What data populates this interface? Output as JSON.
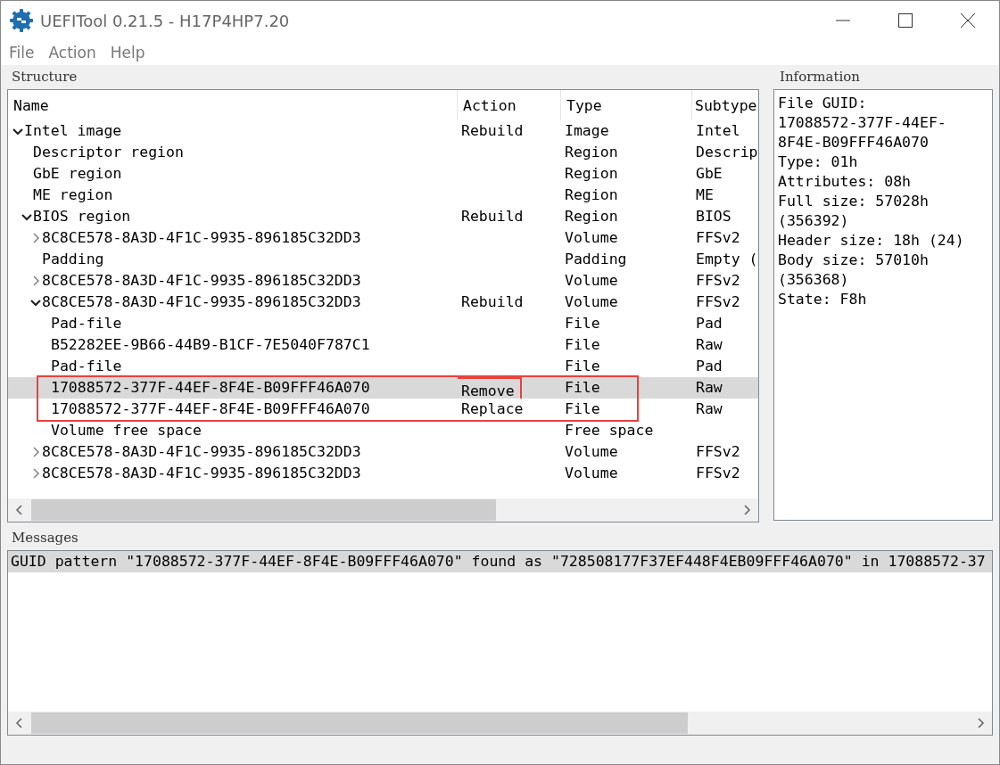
{
  "window": {
    "title": "UEFITool 0.21.5 - H17P4HP7.20"
  },
  "menu": [
    "File",
    "Action",
    "Help"
  ],
  "structure": {
    "title": "Structure",
    "columns": [
      "Name",
      "Action",
      "Type",
      "Subtype"
    ],
    "rows": [
      {
        "name": "Intel image",
        "action": "Rebuild",
        "type": "Image",
        "subtype": "Intel",
        "expanded": true,
        "children": [
          {
            "name": "Descriptor region",
            "type": "Region",
            "subtype": "Descrip"
          },
          {
            "name": "GbE region",
            "type": "Region",
            "subtype": "GbE"
          },
          {
            "name": "ME region",
            "type": "Region",
            "subtype": "ME"
          },
          {
            "name": "BIOS region",
            "action": "Rebuild",
            "type": "Region",
            "subtype": "BIOS",
            "expanded": true,
            "children": [
              {
                "name": "8C8CE578-8A3D-4F1C-9935-896185C32DD3",
                "type": "Volume",
                "subtype": "FFSv2",
                "expanded": false
              },
              {
                "name": "Padding",
                "type": "Padding",
                "subtype": "Empty ("
              },
              {
                "name": "8C8CE578-8A3D-4F1C-9935-896185C32DD3",
                "type": "Volume",
                "subtype": "FFSv2",
                "expanded": false
              },
              {
                "name": "8C8CE578-8A3D-4F1C-9935-896185C32DD3",
                "action": "Rebuild",
                "type": "Volume",
                "subtype": "FFSv2",
                "expanded": true,
                "children": [
                  {
                    "name": "Pad-file",
                    "type": "File",
                    "subtype": "Pad"
                  },
                  {
                    "name": "B52282EE-9B66-44B9-B1CF-7E5040F787C1",
                    "type": "File",
                    "subtype": "Raw"
                  },
                  {
                    "name": "Pad-file",
                    "type": "File",
                    "subtype": "Pad"
                  },
                  {
                    "name": "17088572-377F-44EF-8F4E-B09FFF46A070",
                    "action": "Remove",
                    "type": "File",
                    "subtype": "Raw",
                    "selected": true,
                    "marked": true,
                    "action_marked": true
                  },
                  {
                    "name": "17088572-377F-44EF-8F4E-B09FFF46A070",
                    "action": "Replace",
                    "type": "File",
                    "subtype": "Raw",
                    "selected": false,
                    "marked": true
                  },
                  {
                    "name": "Volume free space",
                    "type": "Free space"
                  }
                ]
              },
              {
                "name": "8C8CE578-8A3D-4F1C-9935-896185C32DD3",
                "type": "Volume",
                "subtype": "FFSv2",
                "expanded": false
              },
              {
                "name": "8C8CE578-8A3D-4F1C-9935-896185C32DD3",
                "type": "Volume",
                "subtype": "FFSv2",
                "expanded": false
              }
            ]
          }
        ]
      }
    ]
  },
  "information": {
    "title": "Information",
    "lines": [
      "File GUID:",
      "17088572-377F-44EF-8F4E-B09FFF46A070",
      "Type: 01h",
      "Attributes: 08h",
      "Full size: 57028h (356392)",
      "Header size: 18h (24)",
      "Body size: 57010h (356368)",
      "State: F8h"
    ]
  },
  "messages": {
    "title": "Messages",
    "items": [
      {
        "text": "GUID pattern \"17088572-377F-44EF-8F4E-B09FFF46A070\" found as \"728508177F37EF448F4EB09FFF46A070\" in 17088572-37",
        "selected": true
      }
    ]
  }
}
